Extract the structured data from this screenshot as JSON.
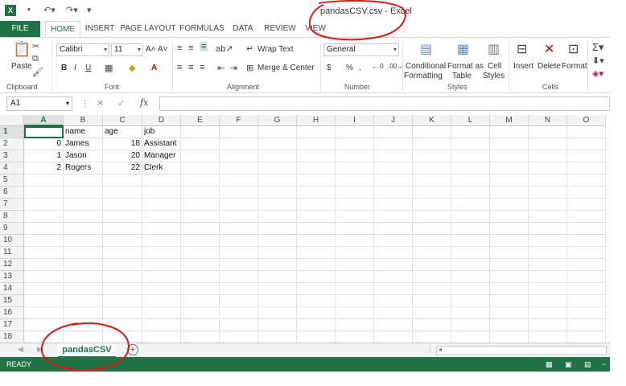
{
  "window": {
    "title": "pandasCSV.csv - Excel",
    "logo": "X"
  },
  "tabs": [
    "FILE",
    "HOME",
    "INSERT",
    "PAGE LAYOUT",
    "FORMULAS",
    "DATA",
    "REVIEW",
    "VIEW"
  ],
  "ribbon": {
    "clipboard": {
      "paste_label": "Paste",
      "group_label": "Clipboard"
    },
    "font": {
      "name": "Calibri",
      "size": "11",
      "group_label": "Font",
      "bold": "B",
      "italic": "I",
      "underline": "U"
    },
    "alignment": {
      "wrap_text": "Wrap Text",
      "merge_center": "Merge & Center",
      "group_label": "Alignment"
    },
    "number": {
      "format": "General",
      "currency": "$",
      "percent": "%",
      "comma": ",",
      "group_label": "Number"
    },
    "styles": {
      "conditional": [
        "Conditional",
        "Formatting"
      ],
      "format_table": [
        "Format as",
        "Table"
      ],
      "cell_styles": [
        "Cell",
        "Styles"
      ],
      "group_label": "Styles"
    },
    "cells": {
      "insert": "Insert",
      "delete": "Delete",
      "format": "Format",
      "group_label": "Cells"
    }
  },
  "formula_bar": {
    "name_box": "A1",
    "fx": "fx",
    "value": ""
  },
  "grid": {
    "columns": [
      "A",
      "B",
      "C",
      "D",
      "E",
      "F",
      "G",
      "H",
      "I",
      "J",
      "K",
      "L",
      "M",
      "N",
      "O"
    ],
    "rows": [
      "1",
      "2",
      "3",
      "4",
      "5",
      "6",
      "7",
      "8",
      "9",
      "10",
      "11",
      "12",
      "13",
      "14",
      "15",
      "16",
      "17",
      "18"
    ],
    "cells": [
      [
        "",
        "name",
        "age",
        "job"
      ],
      [
        "0",
        "James",
        "18",
        "Assistant"
      ],
      [
        "1",
        "Jason",
        "20",
        "Manager"
      ],
      [
        "2",
        "Rogers",
        "22",
        "Clerk"
      ]
    ],
    "selected_cell": "A1"
  },
  "sheets": {
    "active": "pandasCSV",
    "add": "+"
  },
  "status": {
    "text": "READY"
  },
  "colors": {
    "accent": "#217346",
    "annotation": "#e0141b"
  }
}
